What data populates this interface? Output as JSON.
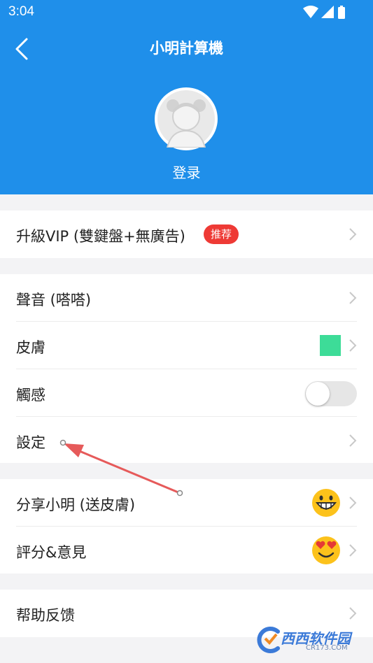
{
  "status_bar": {
    "time": "3:04"
  },
  "header": {
    "title": "小明計算機",
    "login_label": "登录",
    "back_icon": "chevron-left-icon",
    "background_color": "#1f8fea"
  },
  "group_vip": {
    "items": [
      {
        "label": "升級VIP (雙鍵盤+無廣告)",
        "badge": "推荐",
        "badge_color": "#ee3a35"
      }
    ]
  },
  "group_settings": {
    "items": [
      {
        "label": "聲音 (嗒嗒)"
      },
      {
        "label": "皮膚",
        "swatch_color": "#3ddc98"
      },
      {
        "label": "觸感",
        "toggle_on": false
      },
      {
        "label": "設定"
      }
    ]
  },
  "group_share": {
    "items": [
      {
        "label": "分享小明 (送皮膚)",
        "icon": "grinning-emoji-icon"
      },
      {
        "label": "評分&意見",
        "icon": "heart-eyes-emoji-icon"
      }
    ]
  },
  "group_help": {
    "items": [
      {
        "label": "帮助反馈"
      }
    ]
  },
  "watermark": {
    "brand": "西西软件园",
    "domain": "CR173.COM"
  }
}
